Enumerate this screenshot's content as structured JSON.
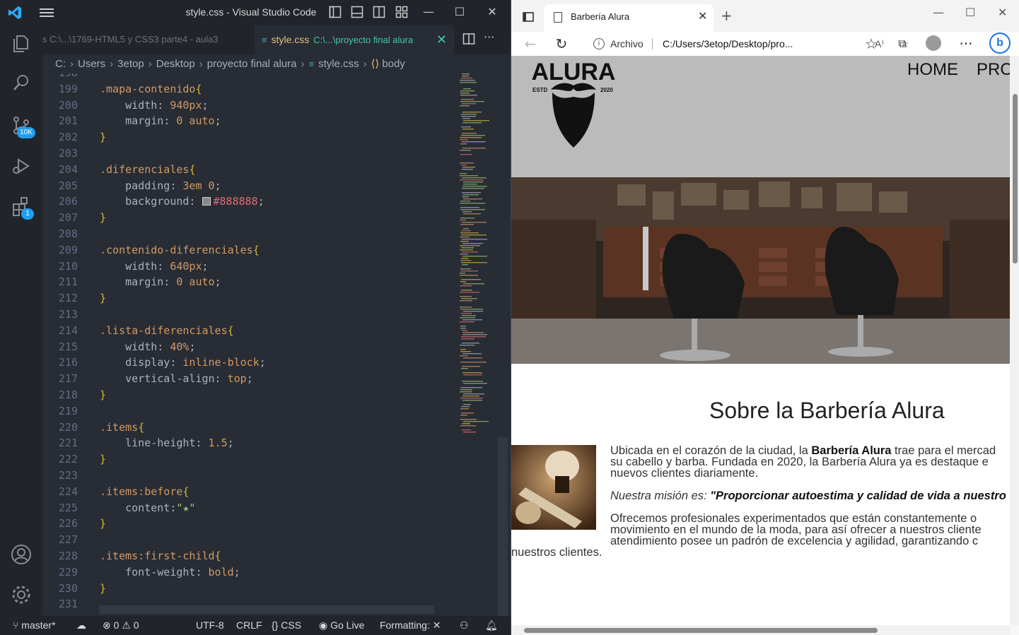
{
  "vscode": {
    "window_title": "style.css - Visual Studio Code",
    "inactive_tab": "s  C:\\...\\1769-HTML5 y CSS3 parte4 - aula3",
    "active_tab": {
      "name": "style.css",
      "path": "C:\\...\\proyecto final alura",
      "close": "✕"
    },
    "breadcrumb": [
      "C:",
      "Users",
      "3etop",
      "Desktop",
      "proyecto final alura",
      "style.css",
      "body"
    ],
    "badges": {
      "source_control": "10K",
      "extensions": "1"
    },
    "code_lines": [
      {
        "n": "198",
        "tokens": []
      },
      {
        "n": "199",
        "tokens": [
          [
            "t-sel",
            ".mapa-contenido"
          ],
          [
            "t-brace",
            "{"
          ]
        ]
      },
      {
        "n": "200",
        "tokens": [
          [
            "t-prop",
            "    width: "
          ],
          [
            "t-num",
            "940px"
          ],
          [
            "t-pun",
            ";"
          ]
        ]
      },
      {
        "n": "201",
        "tokens": [
          [
            "t-prop",
            "    margin: "
          ],
          [
            "t-num",
            "0 auto"
          ],
          [
            "t-pun",
            ";"
          ]
        ]
      },
      {
        "n": "202",
        "tokens": [
          [
            "t-brace",
            "}"
          ]
        ]
      },
      {
        "n": "203",
        "tokens": []
      },
      {
        "n": "204",
        "tokens": [
          [
            "t-sel",
            ".diferenciales"
          ],
          [
            "t-brace",
            "{"
          ]
        ]
      },
      {
        "n": "205",
        "tokens": [
          [
            "t-prop",
            "    padding: "
          ],
          [
            "t-num",
            "3em 0"
          ],
          [
            "t-pun",
            ";"
          ]
        ]
      },
      {
        "n": "206",
        "tokens": [
          [
            "t-prop",
            "    background: "
          ],
          [
            "swatch",
            ""
          ],
          [
            "t-hex",
            "#888888"
          ],
          [
            "t-pun",
            ";"
          ]
        ]
      },
      {
        "n": "207",
        "tokens": [
          [
            "t-brace",
            "}"
          ]
        ]
      },
      {
        "n": "208",
        "tokens": []
      },
      {
        "n": "209",
        "tokens": [
          [
            "t-sel",
            ".contenido-diferenciales"
          ],
          [
            "t-brace",
            "{"
          ]
        ]
      },
      {
        "n": "210",
        "tokens": [
          [
            "t-prop",
            "    width: "
          ],
          [
            "t-num",
            "640px"
          ],
          [
            "t-pun",
            ";"
          ]
        ]
      },
      {
        "n": "211",
        "tokens": [
          [
            "t-prop",
            "    margin: "
          ],
          [
            "t-num",
            "0 auto"
          ],
          [
            "t-pun",
            ";"
          ]
        ]
      },
      {
        "n": "212",
        "tokens": [
          [
            "t-brace",
            "}"
          ]
        ]
      },
      {
        "n": "213",
        "tokens": []
      },
      {
        "n": "214",
        "tokens": [
          [
            "t-sel",
            ".lista-diferenciales"
          ],
          [
            "t-brace",
            "{"
          ]
        ]
      },
      {
        "n": "215",
        "tokens": [
          [
            "t-prop",
            "    width: "
          ],
          [
            "t-num",
            "40%"
          ],
          [
            "t-pun",
            ";"
          ]
        ]
      },
      {
        "n": "216",
        "tokens": [
          [
            "t-prop",
            "    display: "
          ],
          [
            "t-kw",
            "inline-block"
          ],
          [
            "t-pun",
            ";"
          ]
        ]
      },
      {
        "n": "217",
        "tokens": [
          [
            "t-prop",
            "    vertical-align: "
          ],
          [
            "t-kw",
            "top"
          ],
          [
            "t-pun",
            ";"
          ]
        ]
      },
      {
        "n": "218",
        "tokens": [
          [
            "t-brace",
            "}"
          ]
        ]
      },
      {
        "n": "219",
        "tokens": []
      },
      {
        "n": "220",
        "tokens": [
          [
            "t-sel",
            ".items"
          ],
          [
            "t-brace",
            "{"
          ]
        ]
      },
      {
        "n": "221",
        "tokens": [
          [
            "t-prop",
            "    line-height: "
          ],
          [
            "t-num",
            "1.5"
          ],
          [
            "t-pun",
            ";"
          ]
        ]
      },
      {
        "n": "222",
        "tokens": [
          [
            "t-brace",
            "}"
          ]
        ]
      },
      {
        "n": "223",
        "tokens": []
      },
      {
        "n": "224",
        "tokens": [
          [
            "t-sel",
            ".items:before"
          ],
          [
            "t-brace",
            "{"
          ]
        ]
      },
      {
        "n": "225",
        "tokens": [
          [
            "t-prop",
            "    content:"
          ],
          [
            "t-str",
            "\"★\""
          ]
        ]
      },
      {
        "n": "226",
        "tokens": [
          [
            "t-brace",
            "}"
          ]
        ]
      },
      {
        "n": "227",
        "tokens": []
      },
      {
        "n": "228",
        "tokens": [
          [
            "t-sel",
            ".items:first-child"
          ],
          [
            "t-brace",
            "{"
          ]
        ]
      },
      {
        "n": "229",
        "tokens": [
          [
            "t-prop",
            "    font-weight: "
          ],
          [
            "t-kw",
            "bold"
          ],
          [
            "t-pun",
            ";"
          ]
        ]
      },
      {
        "n": "230",
        "tokens": [
          [
            "t-brace",
            "}"
          ]
        ]
      },
      {
        "n": "231",
        "tokens": []
      }
    ],
    "status": {
      "branch": "master*",
      "errors": "0",
      "warnings": "0",
      "encoding": "UTF-8",
      "eol": "CRLF",
      "language": "CSS",
      "golive": "Go Live",
      "formatting": "Formatting:"
    }
  },
  "edge": {
    "tab_title": "Barbería Alura",
    "address_label": "Archivo",
    "url": "C:/Users/3etop/Desktop/pro...",
    "page": {
      "logo_text": "ALURA",
      "logo_estd": "ESTD",
      "logo_year": "2020",
      "nav": [
        "HOME",
        "PRO"
      ],
      "about_title": "Sobre la Barbería Alura",
      "p1_line1_a": "Ubicada en el corazón de la ciudad, la ",
      "p1_line1_b": "Barbería Alura",
      "p1_line1_c": " trae para el mercad",
      "p1_line2": "su cabello y barba. Fundada en 2020, la Barbería Alura ya es destaque e",
      "p1_line3": "nuevos clientes diariamente.",
      "p2_a": "Nuestra misión es: ",
      "p2_b": "\"Proporcionar autoestima y calidad de vida a nuestro",
      "p3_line1": "Ofrecemos profesionales experimentados que están constantemente o",
      "p3_line2": "movimiento en el mundo de la moda, para así ofrecer a nuestros cliente",
      "p3_line3": "atendimiento posee un padrón de excelencia y agilidad, garantizando c",
      "p3_line4": "nuestros clientes."
    }
  }
}
